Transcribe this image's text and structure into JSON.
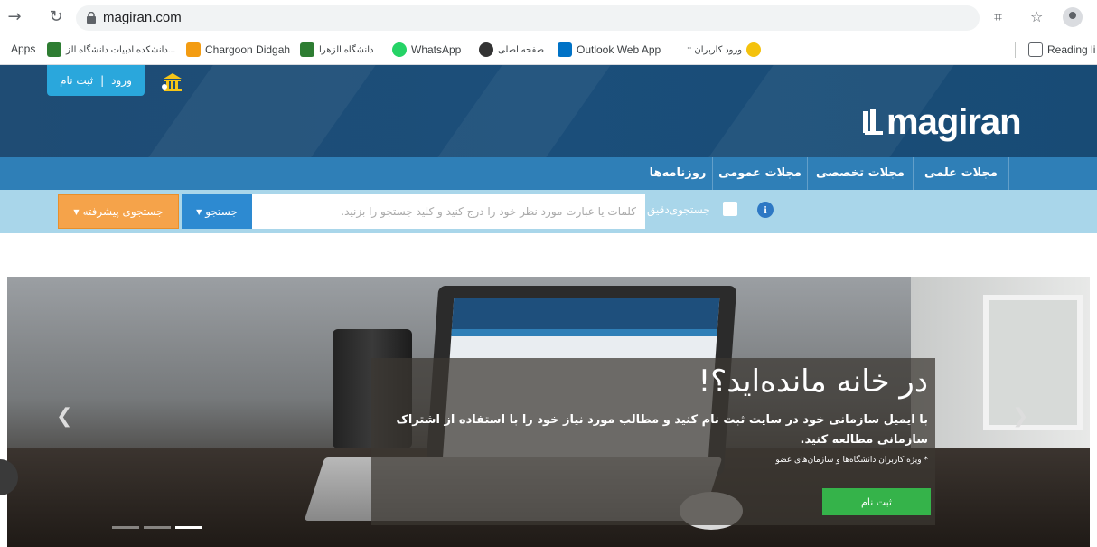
{
  "browser": {
    "url": "magiran.com",
    "bookmarks": [
      {
        "label": "Apps",
        "color": "#4285f4"
      },
      {
        "label": "دانشکده ادبیات دانشگاه الز...",
        "color": "#2e7d32"
      },
      {
        "label": "Chargoon Didgah",
        "color": "#f39c12"
      },
      {
        "label": "دانشگاه الزهرا",
        "color": "#2e7d32"
      },
      {
        "label": "WhatsApp",
        "color": "#25d366"
      },
      {
        "label": "صفحه اصلی",
        "color": "#333333"
      },
      {
        "label": "Outlook Web App",
        "color": "#0072c6"
      },
      {
        "label": ":: ورود کاربران",
        "color": "#f4c20d"
      }
    ],
    "reading_list": "Reading li"
  },
  "header": {
    "login_label": "ورود",
    "register_label": "ثبت نام",
    "logo": "magiran"
  },
  "nav": {
    "items": [
      "مجلات علمی",
      "مجلات تخصصی",
      "مجلات عمومی",
      "روزنامه‌ها"
    ]
  },
  "search": {
    "placeholder": "کلمات یا عبارت مورد نظر خود را درج کنید و کلید جستجو را بزنید.",
    "button": "جستجو",
    "advanced": "جستجوی پیشرفته",
    "exact": "جستجوی‌دقیق",
    "info": "i"
  },
  "hero": {
    "title": "در خانه مانده‌اید؟!",
    "text": "با ایمیل سازمانی خود در سایت ثبت نام کنید و مطالب مورد نیاز خود را با استفاده از اشتراک سازمانی مطالعه کنید.",
    "note": "* ویژه کاربران دانشگاه‌ها و سازمان‌های عضو",
    "signup": "ثبت نام",
    "slide": 3,
    "slides": 3
  },
  "colors": {
    "header_bg": "#1f4c74",
    "nav_bg": "#2f7fb7",
    "search_bg": "#a9d6ea",
    "search_btn": "#2d8ad1",
    "advanced_btn": "#f5a34a",
    "signup_btn": "#35b34a",
    "login_btn": "#2aa7dc"
  }
}
